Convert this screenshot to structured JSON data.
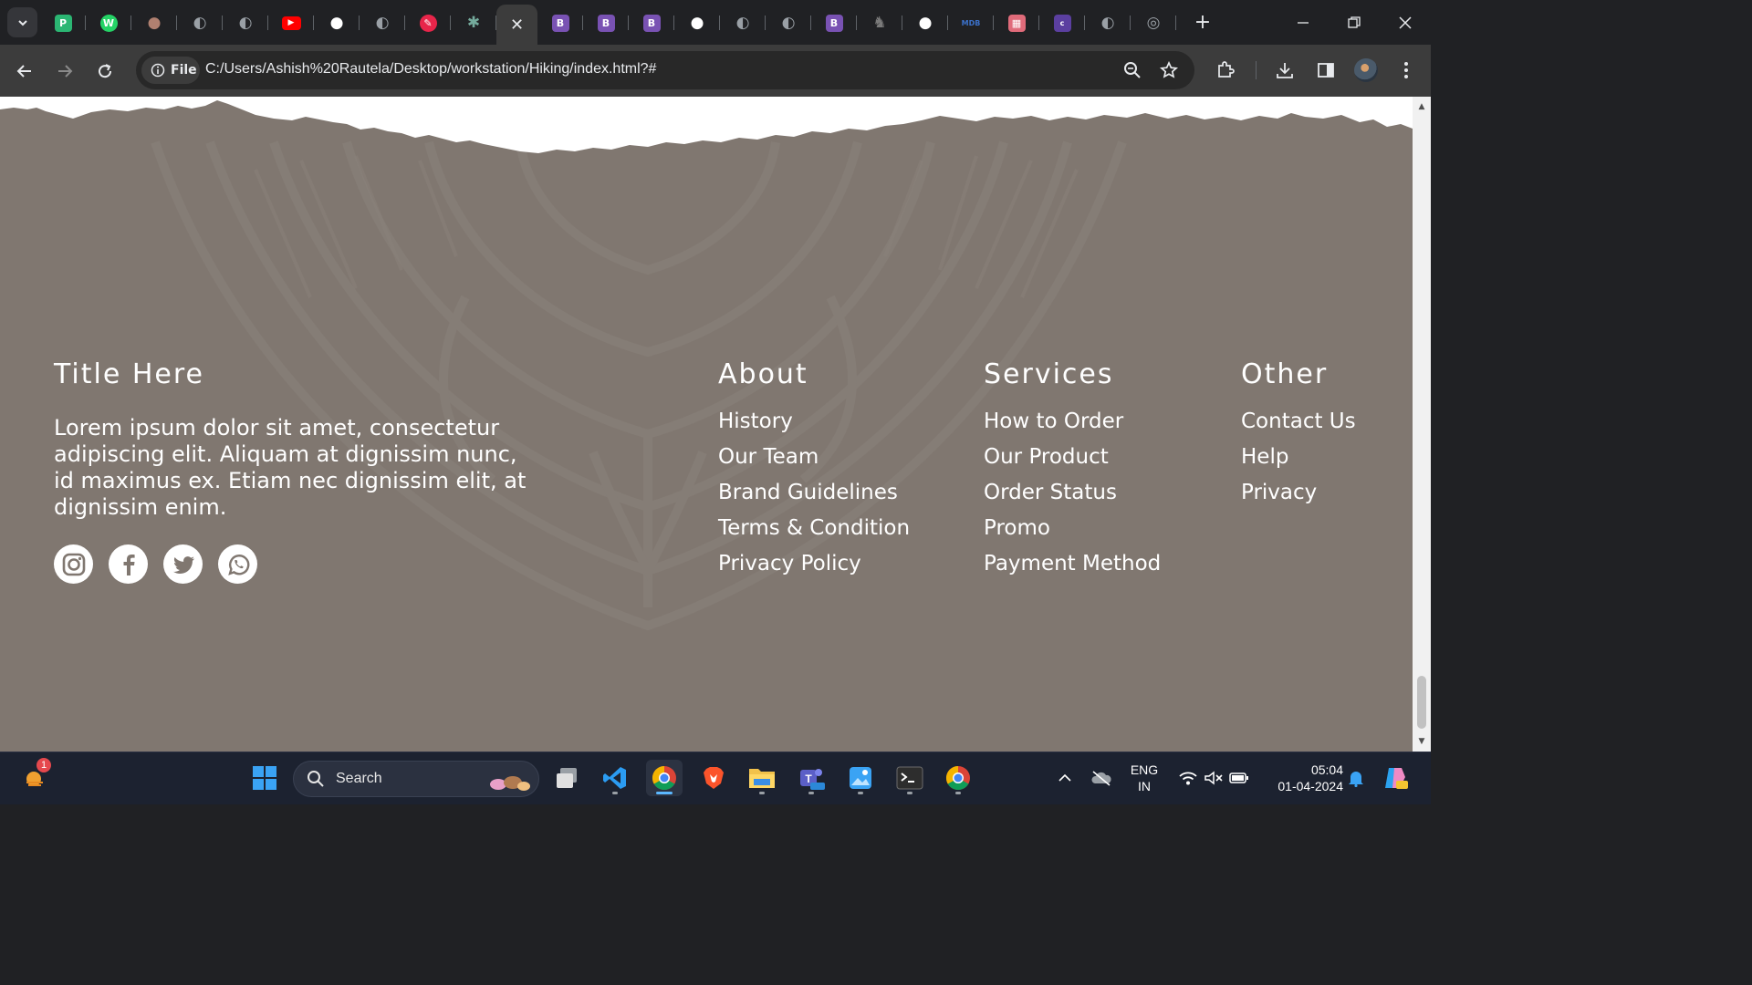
{
  "browser": {
    "tab_count_visible": 25,
    "active_tab_close_label": "✕",
    "new_tab_label": "+",
    "security_chip_label": "File",
    "url": "C:/Users/Ashish%20Rautela/Desktop/workstation/Hiking/index.html?#"
  },
  "tabs": [
    {
      "icon": "pieces-icon",
      "color": "#2bb673",
      "glyph": "P"
    },
    {
      "icon": "whatsapp-icon",
      "color": "#25d366",
      "glyph": "W"
    },
    {
      "icon": "globe-avatar-icon",
      "color": "#b08070",
      "glyph": "●"
    },
    {
      "icon": "globe-icon",
      "color": "#9aa0a6",
      "glyph": "◐"
    },
    {
      "icon": "globe-icon",
      "color": "#9aa0a6",
      "glyph": "◐"
    },
    {
      "icon": "youtube-icon",
      "color": "#ff0000",
      "glyph": "▶"
    },
    {
      "icon": "github-icon",
      "color": "#ffffff",
      "glyph": "●"
    },
    {
      "icon": "globe-icon",
      "color": "#9aa0a6",
      "glyph": "◐"
    },
    {
      "icon": "pen-icon",
      "color": "#e8254a",
      "glyph": "✎"
    },
    {
      "icon": "chatgpt-icon",
      "color": "#74aa9c",
      "glyph": "✱"
    },
    {
      "icon": "close-icon",
      "color": "#3c3c3c",
      "glyph": "",
      "active": true
    },
    {
      "icon": "bootstrap-icon",
      "color": "#7952b3",
      "glyph": "B"
    },
    {
      "icon": "bootstrap-icon",
      "color": "#7952b3",
      "glyph": "B"
    },
    {
      "icon": "bootstrap-icon",
      "color": "#7952b3",
      "glyph": "B"
    },
    {
      "icon": "github-icon",
      "color": "#ffffff",
      "glyph": "●"
    },
    {
      "icon": "globe-icon",
      "color": "#9aa0a6",
      "glyph": "◐"
    },
    {
      "icon": "globe-icon",
      "color": "#9aa0a6",
      "glyph": "◐"
    },
    {
      "icon": "bootstrap-icon",
      "color": "#7952b3",
      "glyph": "B"
    },
    {
      "icon": "rabbit-icon",
      "color": "#7a7a7a",
      "glyph": "♞"
    },
    {
      "icon": "github-icon",
      "color": "#ffffff",
      "glyph": "●"
    },
    {
      "icon": "mdb-icon",
      "color": "#3b71ca",
      "glyph": "MDB"
    },
    {
      "icon": "gallery-icon",
      "color": "#e06b7a",
      "glyph": "▦"
    },
    {
      "icon": "colorlib-icon",
      "color": "#5b3fa0",
      "glyph": "c"
    },
    {
      "icon": "globe-icon",
      "color": "#9aa0a6",
      "glyph": "◐"
    },
    {
      "icon": "chrome-icon",
      "color": "#9aa0a6",
      "glyph": "◎"
    }
  ],
  "footer": {
    "brand": {
      "title": "Title Here",
      "description": "Lorem ipsum dolor sit amet, consectetur adipiscing elit. Aliquam at dignissim nunc, id maximus ex. Etiam nec dignissim elit, at dignissim enim."
    },
    "about": {
      "title": "About",
      "links": [
        "History",
        "Our Team",
        "Brand Guidelines",
        "Terms & Condition",
        "Privacy Policy"
      ]
    },
    "services": {
      "title": "Services",
      "links": [
        "How to Order",
        "Our Product",
        "Order Status",
        "Promo",
        "Payment Method"
      ]
    },
    "other": {
      "title": "Other",
      "links": [
        "Contact Us",
        "Help",
        "Privacy"
      ]
    },
    "socials": [
      "instagram-icon",
      "facebook-icon",
      "twitter-icon",
      "whatsapp-icon"
    ]
  },
  "taskbar": {
    "notification_badge": "1",
    "search_placeholder": "Search",
    "language_line1": "ENG",
    "language_line2": "IN",
    "time": "05:04",
    "date": "01-04-2024"
  },
  "colors": {
    "footer_bg": "#807770",
    "footer_text": "#ffffff",
    "browser_frame": "#202124",
    "toolbar": "#3c3c3c",
    "taskbar": "#1c2230"
  }
}
